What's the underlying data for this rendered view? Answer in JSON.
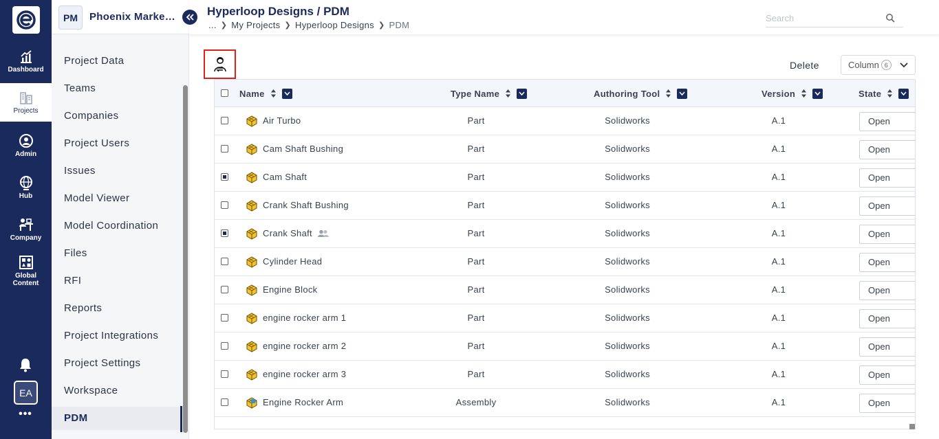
{
  "rail": {
    "items": [
      {
        "label": "Dashboard"
      },
      {
        "label": "Projects"
      },
      {
        "label": "Admin"
      },
      {
        "label": "Hub"
      },
      {
        "label": "Company"
      },
      {
        "label": "Global Content"
      }
    ],
    "avatar": "EA",
    "more": "•••"
  },
  "sidebar": {
    "badge": "PM",
    "project_name": "Phoenix Marke…",
    "items": [
      {
        "label": "Project Data"
      },
      {
        "label": "Teams"
      },
      {
        "label": "Companies"
      },
      {
        "label": "Project Users"
      },
      {
        "label": "Issues"
      },
      {
        "label": "Model Viewer"
      },
      {
        "label": "Model Coordination"
      },
      {
        "label": "Files"
      },
      {
        "label": "RFI"
      },
      {
        "label": "Reports"
      },
      {
        "label": "Project Integrations"
      },
      {
        "label": "Project Settings"
      },
      {
        "label": "Workspace"
      },
      {
        "label": "PDM"
      }
    ]
  },
  "header": {
    "title": "Hyperloop Designs / PDM",
    "breadcrumb": [
      "...",
      "My Projects",
      "Hyperloop Designs",
      "PDM"
    ],
    "search_placeholder": "Search"
  },
  "toolbar": {
    "delete_label": "Delete",
    "column_label": "Column",
    "column_count": "6"
  },
  "table": {
    "columns": [
      "Name",
      "Type Name",
      "Authoring Tool",
      "Version",
      "State"
    ],
    "rows": [
      {
        "name": "Air Turbo",
        "type": "Part",
        "tool": "Solidworks",
        "version": "A.1",
        "state": "Open",
        "checked": false
      },
      {
        "name": "Cam Shaft Bushing",
        "type": "Part",
        "tool": "Solidworks",
        "version": "A.1",
        "state": "Open",
        "checked": false
      },
      {
        "name": "Cam Shaft",
        "type": "Part",
        "tool": "Solidworks",
        "version": "A.1",
        "state": "Open",
        "checked": true
      },
      {
        "name": "Crank Shaft Bushing",
        "type": "Part",
        "tool": "Solidworks",
        "version": "A.1",
        "state": "Open",
        "checked": false
      },
      {
        "name": "Crank Shaft",
        "type": "Part",
        "tool": "Solidworks",
        "version": "A.1",
        "state": "Open",
        "checked": true,
        "shared": true
      },
      {
        "name": "Cylinder Head",
        "type": "Part",
        "tool": "Solidworks",
        "version": "A.1",
        "state": "Open",
        "checked": false
      },
      {
        "name": "Engine Block",
        "type": "Part",
        "tool": "Solidworks",
        "version": "A.1",
        "state": "Open",
        "checked": false
      },
      {
        "name": "engine rocker arm 1",
        "type": "Part",
        "tool": "Solidworks",
        "version": "A.1",
        "state": "Open",
        "checked": false
      },
      {
        "name": "engine rocker arm 2",
        "type": "Part",
        "tool": "Solidworks",
        "version": "A.1",
        "state": "Open",
        "checked": false
      },
      {
        "name": "engine rocker arm 3",
        "type": "Part",
        "tool": "Solidworks",
        "version": "A.1",
        "state": "Open",
        "checked": false
      },
      {
        "name": "Engine Rocker Arm",
        "type": "Assembly",
        "tool": "Solidworks",
        "version": "A.1",
        "state": "Open",
        "checked": false
      }
    ]
  },
  "colors": {
    "navy": "#1b2a5c",
    "highlight_border": "#e0201c",
    "part_icon": "#f2c230"
  }
}
